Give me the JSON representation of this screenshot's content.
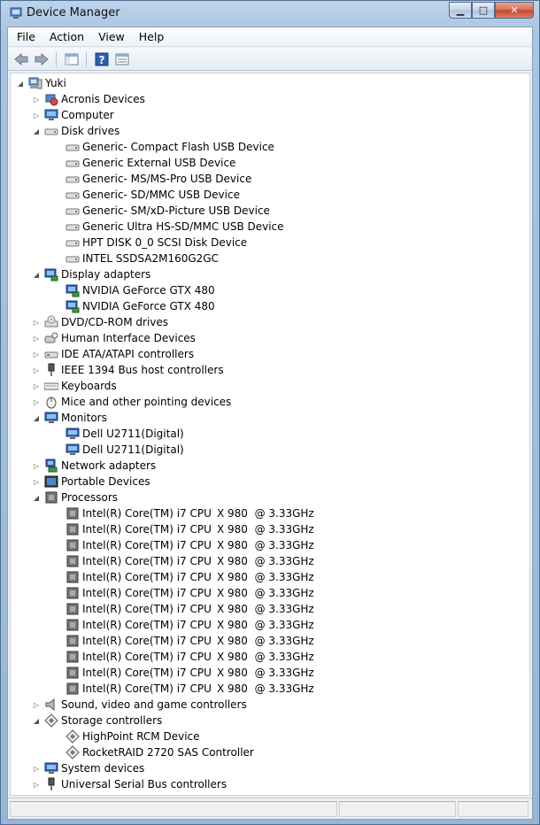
{
  "window": {
    "title": "Device Manager"
  },
  "caption": {
    "minimize": "▁",
    "maximize": "□",
    "close": "✕"
  },
  "menu": [
    {
      "label": "File"
    },
    {
      "label": "Action"
    },
    {
      "label": "View"
    },
    {
      "label": "Help"
    }
  ],
  "toolbar": {
    "buttons": [
      "back-arrow-icon",
      "forward-arrow-icon",
      "show-hide-console-tree-icon",
      "help-icon",
      "properties-icon"
    ]
  },
  "tree": {
    "root": {
      "label": "Yuki",
      "icon": "computer-icon"
    },
    "categories": [
      {
        "label": "Acronis Devices",
        "icon": "acronis-devices-icon",
        "expanded": false
      },
      {
        "label": "Computer",
        "icon": "computer-monitor-icon",
        "expanded": false
      },
      {
        "label": "Disk drives",
        "icon": "disk-drive-icon",
        "expanded": true,
        "children": [
          "Generic- Compact Flash USB Device",
          "Generic External USB Device",
          "Generic- MS/MS-Pro USB Device",
          "Generic- SD/MMC USB Device",
          "Generic- SM/xD-Picture USB Device",
          "Generic Ultra HS-SD/MMC USB Device",
          "HPT DISK 0_0 SCSI Disk Device",
          "INTEL SSDSA2M160G2GC"
        ]
      },
      {
        "label": "Display adapters",
        "icon": "display-adapter-icon",
        "expanded": true,
        "children": [
          "NVIDIA GeForce GTX 480",
          "NVIDIA GeForce GTX 480"
        ]
      },
      {
        "label": "DVD/CD-ROM drives",
        "icon": "dvd-drive-icon",
        "expanded": false
      },
      {
        "label": "Human Interface Devices",
        "icon": "hid-icon",
        "expanded": false
      },
      {
        "label": "IDE ATA/ATAPI controllers",
        "icon": "ide-controller-icon",
        "expanded": false
      },
      {
        "label": "IEEE 1394 Bus host controllers",
        "icon": "ieee1394-icon",
        "expanded": false
      },
      {
        "label": "Keyboards",
        "icon": "keyboard-icon",
        "expanded": false
      },
      {
        "label": "Mice and other pointing devices",
        "icon": "mouse-icon",
        "expanded": false
      },
      {
        "label": "Monitors",
        "icon": "monitor-icon",
        "expanded": true,
        "children": [
          "Dell U2711(Digital)",
          "Dell U2711(Digital)"
        ]
      },
      {
        "label": "Network adapters",
        "icon": "network-adapter-icon",
        "expanded": false
      },
      {
        "label": "Portable Devices",
        "icon": "portable-device-icon",
        "expanded": false
      },
      {
        "label": "Processors",
        "icon": "processor-icon",
        "expanded": true,
        "children": [
          {
            "name": "Intel(R) Core(TM) i7 CPU",
            "model": "X 980  @ 3.33GHz"
          },
          {
            "name": "Intel(R) Core(TM) i7 CPU",
            "model": "X 980  @ 3.33GHz"
          },
          {
            "name": "Intel(R) Core(TM) i7 CPU",
            "model": "X 980  @ 3.33GHz"
          },
          {
            "name": "Intel(R) Core(TM) i7 CPU",
            "model": "X 980  @ 3.33GHz"
          },
          {
            "name": "Intel(R) Core(TM) i7 CPU",
            "model": "X 980  @ 3.33GHz"
          },
          {
            "name": "Intel(R) Core(TM) i7 CPU",
            "model": "X 980  @ 3.33GHz"
          },
          {
            "name": "Intel(R) Core(TM) i7 CPU",
            "model": "X 980  @ 3.33GHz"
          },
          {
            "name": "Intel(R) Core(TM) i7 CPU",
            "model": "X 980  @ 3.33GHz"
          },
          {
            "name": "Intel(R) Core(TM) i7 CPU",
            "model": "X 980  @ 3.33GHz"
          },
          {
            "name": "Intel(R) Core(TM) i7 CPU",
            "model": "X 980  @ 3.33GHz"
          },
          {
            "name": "Intel(R) Core(TM) i7 CPU",
            "model": "X 980  @ 3.33GHz"
          },
          {
            "name": "Intel(R) Core(TM) i7 CPU",
            "model": "X 980  @ 3.33GHz"
          }
        ]
      },
      {
        "label": "Sound, video and game controllers",
        "icon": "speaker-icon",
        "expanded": false
      },
      {
        "label": "Storage controllers",
        "icon": "storage-controller-icon",
        "expanded": true,
        "children": [
          "HighPoint RCM Device",
          "RocketRAID 2720 SAS Controller"
        ]
      },
      {
        "label": "System devices",
        "icon": "system-devices-icon",
        "expanded": false
      },
      {
        "label": "Universal Serial Bus controllers",
        "icon": "usb-icon",
        "expanded": false
      }
    ]
  },
  "colors": {
    "titlebar": "#bcd3ea",
    "close_button": "#c6452b",
    "tree_background": "#ffffff"
  }
}
